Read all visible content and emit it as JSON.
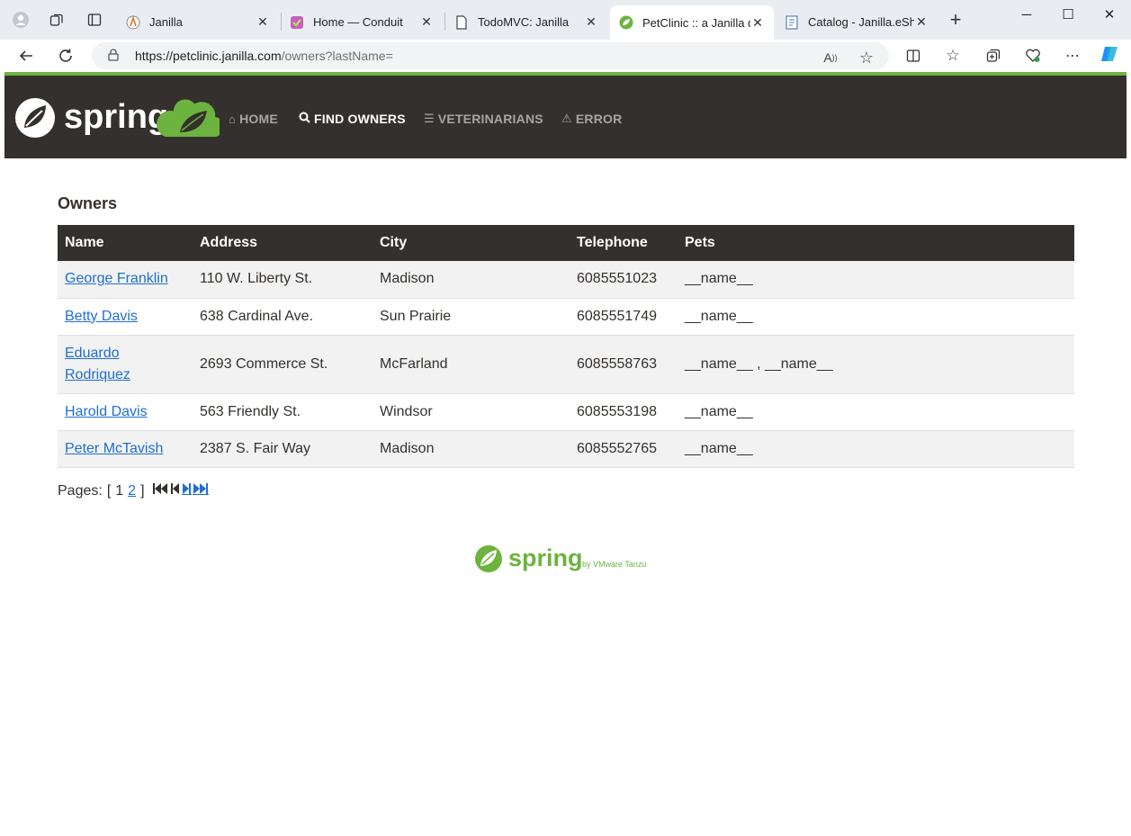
{
  "browser": {
    "tabs": [
      {
        "title": "Janilla",
        "icon": "janilla-icon"
      },
      {
        "title": "Home — Conduit",
        "icon": "conduit-icon"
      },
      {
        "title": "TodoMVC: Janilla",
        "icon": "document-icon"
      },
      {
        "title": "PetClinic :: a Janilla demonstration",
        "icon": "spring-leaf-icon",
        "active": true
      },
      {
        "title": "Catalog - Janilla.eShop",
        "icon": "catalog-icon"
      }
    ],
    "url_host": "https://petclinic.janilla.com",
    "url_path": "/owners?lastName="
  },
  "navbar": {
    "brand": "spring",
    "items": [
      {
        "label": "HOME",
        "icon": "home-icon"
      },
      {
        "label": "FIND OWNERS",
        "icon": "search-icon",
        "active": true
      },
      {
        "label": "VETERINARIANS",
        "icon": "list-icon"
      },
      {
        "label": "ERROR",
        "icon": "warning-icon"
      }
    ]
  },
  "main": {
    "heading": "Owners",
    "columns": [
      "Name",
      "Address",
      "City",
      "Telephone",
      "Pets"
    ],
    "rows": [
      {
        "name": "George Franklin",
        "address": "110 W. Liberty St.",
        "city": "Madison",
        "telephone": "6085551023",
        "pets": "__name__"
      },
      {
        "name": "Betty Davis",
        "address": "638 Cardinal Ave.",
        "city": "Sun Prairie",
        "telephone": "6085551749",
        "pets": "__name__"
      },
      {
        "name": "Eduardo Rodriquez",
        "address": "2693 Commerce St.",
        "city": "McFarland",
        "telephone": "6085558763",
        "pets": "__name__ , __name__"
      },
      {
        "name": "Harold Davis",
        "address": "563 Friendly St.",
        "city": "Windsor",
        "telephone": "6085553198",
        "pets": "__name__"
      },
      {
        "name": "Peter McTavish",
        "address": "2387 S. Fair Way",
        "city": "Madison",
        "telephone": "6085552765",
        "pets": "__name__"
      }
    ],
    "pager": {
      "label": "Pages:",
      "open": "[",
      "current": "1",
      "next_page": "2",
      "close": "]"
    }
  },
  "footer": {
    "brand": "spring",
    "tagline": "by VMware Tanzu"
  },
  "colors": {
    "accent": "#6db33f",
    "navbar": "#34302d",
    "link": "#1f6fd1"
  }
}
